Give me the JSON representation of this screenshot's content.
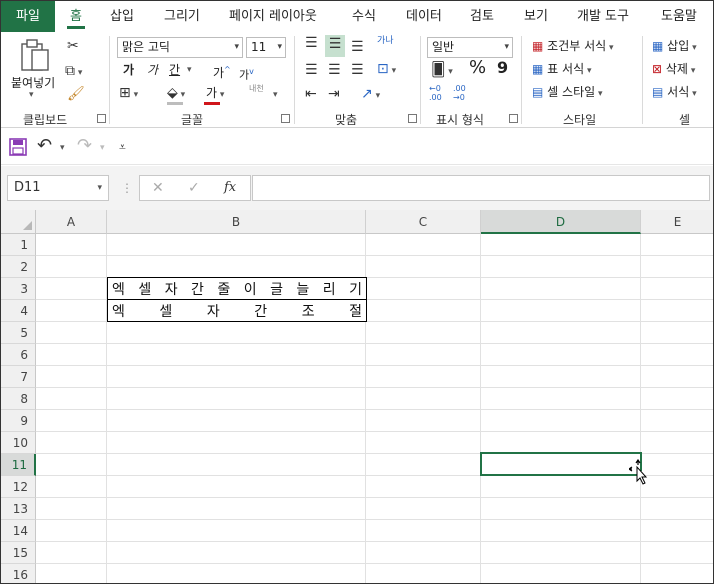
{
  "tabs": [
    "파일",
    "홈",
    "삽입",
    "그리기",
    "페이지 레이아웃",
    "수식",
    "데이터",
    "검토",
    "보기",
    "개발 도구",
    "도움말"
  ],
  "ribbon": {
    "clipboard": {
      "paste_label": "붙여넣기",
      "group_label": "클립보드"
    },
    "font": {
      "font_name": "맑은 고딕",
      "font_size": "11",
      "bold": "가",
      "italic": "가",
      "underline": "간",
      "grow": "가",
      "shrink": "가",
      "font_color_glyph": "가",
      "phonetic": "내천",
      "group_label": "글꼴"
    },
    "alignment": {
      "wrap_glyph": "가나",
      "group_label": "맞춤"
    },
    "number": {
      "format": "일반",
      "percent": "%",
      "comma": "9",
      "inc_decimal": "←0 .00",
      "dec_decimal": ".00 →0",
      "group_label": "표시 형식"
    },
    "styles": {
      "conditional": "조건부 서식",
      "table": "표 서식",
      "cell": "셀 스타일",
      "group_label": "스타일"
    },
    "cells": {
      "insert": "삽입",
      "delete": "삭제",
      "format": "서식",
      "group_label": "셀"
    }
  },
  "formula_bar": {
    "name_box": "D11",
    "fx": "fx",
    "formula": ""
  },
  "grid": {
    "columns": [
      "A",
      "B",
      "C",
      "D",
      "E"
    ],
    "selected_column": "D",
    "rows": [
      "1",
      "2",
      "3",
      "4",
      "5",
      "6",
      "7",
      "8",
      "9",
      "10",
      "11",
      "12",
      "13",
      "14",
      "15",
      "16"
    ],
    "selected_row": "11",
    "cells": {
      "B3": [
        "엑",
        "셀",
        "자",
        "간",
        "줄",
        "이",
        "글",
        "늘",
        "리",
        "기"
      ],
      "B4": [
        "엑",
        "셀",
        "자",
        "간",
        "조",
        "절"
      ]
    }
  }
}
